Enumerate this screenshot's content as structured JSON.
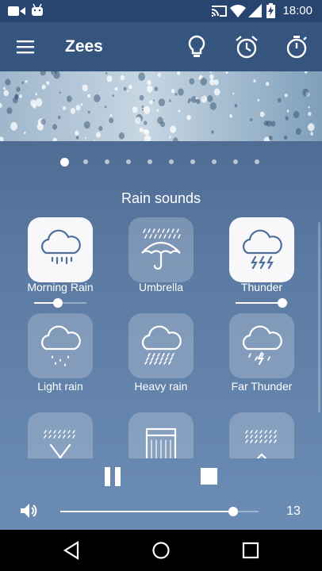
{
  "status_bar": {
    "time": "18:00",
    "icons": [
      "video-camera-icon",
      "android-icon",
      "cast-icon",
      "wifi-icon",
      "signal-icon",
      "battery-charging-icon"
    ]
  },
  "app_bar": {
    "title": "Zees",
    "icons": [
      "menu-icon",
      "lightbulb-icon",
      "alarm-clock-icon",
      "stopwatch-icon"
    ]
  },
  "carousel": {
    "page_count": 10,
    "active_index": 0
  },
  "section": {
    "title": "Rain sounds"
  },
  "sounds": [
    {
      "label": "Morning Rain",
      "icon": "cloud-drizzle-icon",
      "active": true,
      "volume": 0.45
    },
    {
      "label": "Umbrella",
      "icon": "umbrella-rain-icon",
      "active": false
    },
    {
      "label": "Thunder",
      "icon": "cloud-lightning-icon",
      "active": true,
      "volume": 0.9
    },
    {
      "label": "Light rain",
      "icon": "cloud-light-rain-icon",
      "active": false
    },
    {
      "label": "Heavy rain",
      "icon": "cloud-heavy-rain-icon",
      "active": false
    },
    {
      "label": "Far Thunder",
      "icon": "cloud-far-thunder-icon",
      "active": false
    },
    {
      "label": "",
      "icon": "rain-on-tent-icon",
      "active": false
    },
    {
      "label": "",
      "icon": "rain-on-window-icon",
      "active": false
    },
    {
      "label": "",
      "icon": "rain-on-roof-icon",
      "active": false
    }
  ],
  "player": {
    "pause_icon": "pause-icon",
    "stop_icon": "stop-icon",
    "volume_icon": "speaker-icon",
    "volume_fraction": 0.87,
    "volume_value": "13"
  },
  "nav_bar": {
    "icons": [
      "back-icon",
      "home-icon",
      "recents-icon"
    ]
  },
  "colors": {
    "background_top": "#3e5a82",
    "background_bottom": "#6d8fb7",
    "app_bar": "#35557f",
    "status_bar": "#27456f",
    "active_tile": "#f8f8fb",
    "active_icon": "#4d6f98"
  }
}
